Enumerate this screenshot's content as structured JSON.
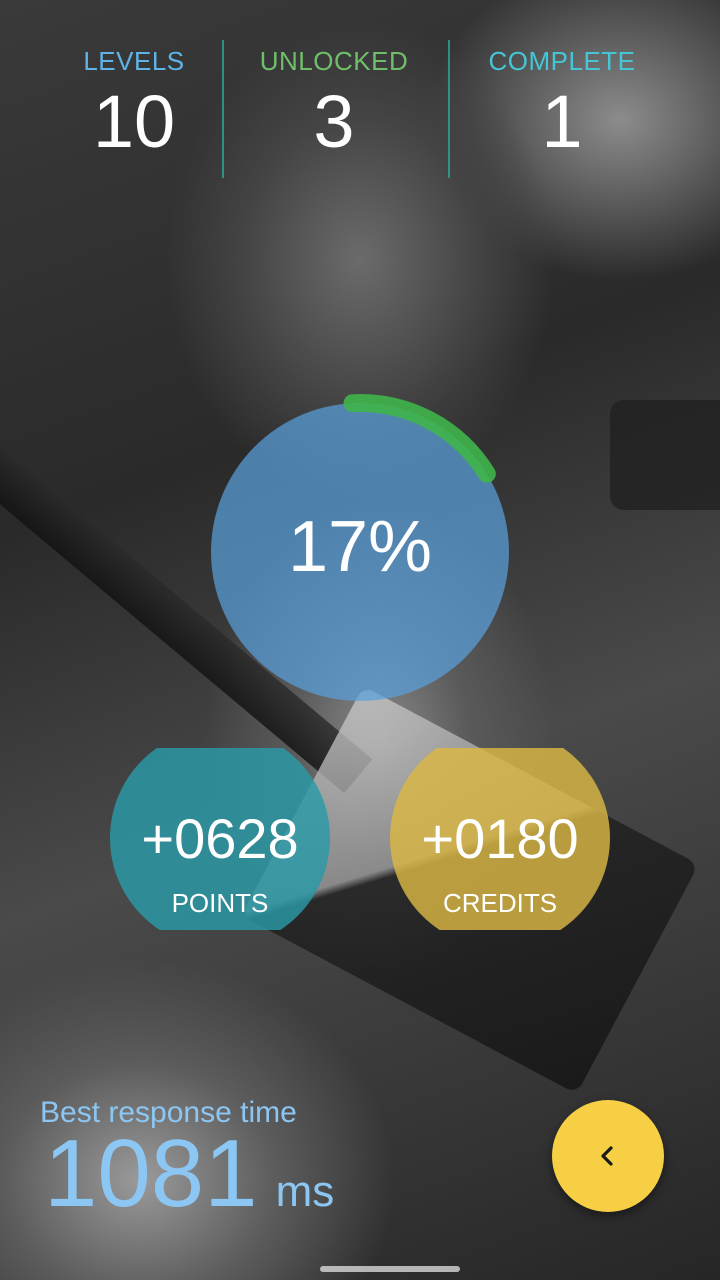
{
  "stats": {
    "levels": {
      "label": "LEVELS",
      "value": "10",
      "color": "#5fb3e6"
    },
    "unlocked": {
      "label": "UNLOCKED",
      "value": "3",
      "color": "#6fbf6a"
    },
    "complete": {
      "label": "COMPLETE",
      "value": "1",
      "color": "#45c6d6"
    }
  },
  "progress": {
    "percent_text": "17%",
    "fraction": 0.17,
    "circle_color": "#5a9fdc",
    "arc_color": "#3fb54a"
  },
  "points": {
    "value": "+0628",
    "label": "POINTS",
    "color": "#2a9aa6"
  },
  "credits": {
    "value": "+0180",
    "label": "CREDITS",
    "color": "#d9b744"
  },
  "best_response": {
    "title": "Best response time",
    "value": "1081",
    "unit": "ms",
    "color": "#8cc6f2"
  },
  "fab": {
    "icon": "chevron-left-icon",
    "color": "#f7cf45"
  }
}
